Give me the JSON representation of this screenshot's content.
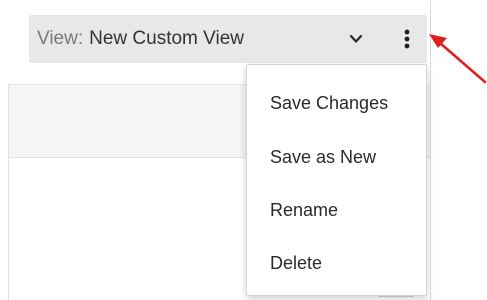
{
  "view_selector": {
    "label": "View:",
    "value": "New Custom View"
  },
  "menu": {
    "items": [
      {
        "label": "Save Changes"
      },
      {
        "label": "Save as New"
      },
      {
        "label": "Rename"
      },
      {
        "label": "Delete"
      }
    ]
  },
  "icons": {
    "chevron": "chevron-down-icon",
    "kebab": "more-vertical-icon",
    "arrow": "annotation-arrow"
  },
  "colors": {
    "bar_background": "#e8e8e8",
    "arrow": "#e02020",
    "menu_text": "#2a2a2a"
  }
}
